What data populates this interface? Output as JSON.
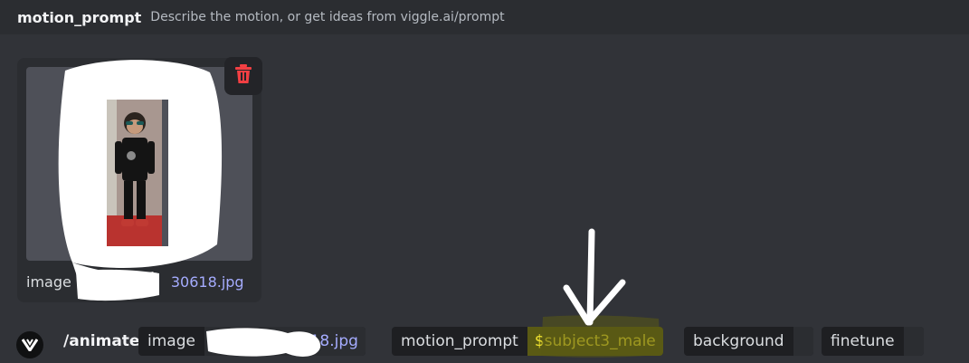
{
  "option_header": {
    "name": "motion_prompt",
    "description": "Describe the motion, or get ideas from viggle.ai/prompt"
  },
  "attachment": {
    "filename_prefix": "image",
    "filename_visible_suffix": "30618.jpg",
    "delete_icon": "trash-icon"
  },
  "command_bar": {
    "app_icon": "viggle-logo-icon",
    "command": "/animate",
    "options": [
      {
        "name": "image",
        "value": "618.jpg"
      },
      {
        "name": "motion_prompt",
        "value": "$subject3_male"
      },
      {
        "name": "background",
        "value": ""
      },
      {
        "name": "finetune",
        "value": ""
      }
    ]
  },
  "colors": {
    "background": "#313338",
    "header_bg": "#2b2d31",
    "chip_bg": "#1e1f22",
    "link": "#a5acff",
    "highlight_text": "#f0e22f",
    "highlight_marker": "#5a5a14",
    "danger": "#f23f43",
    "annotation_white": "#ffffff"
  }
}
